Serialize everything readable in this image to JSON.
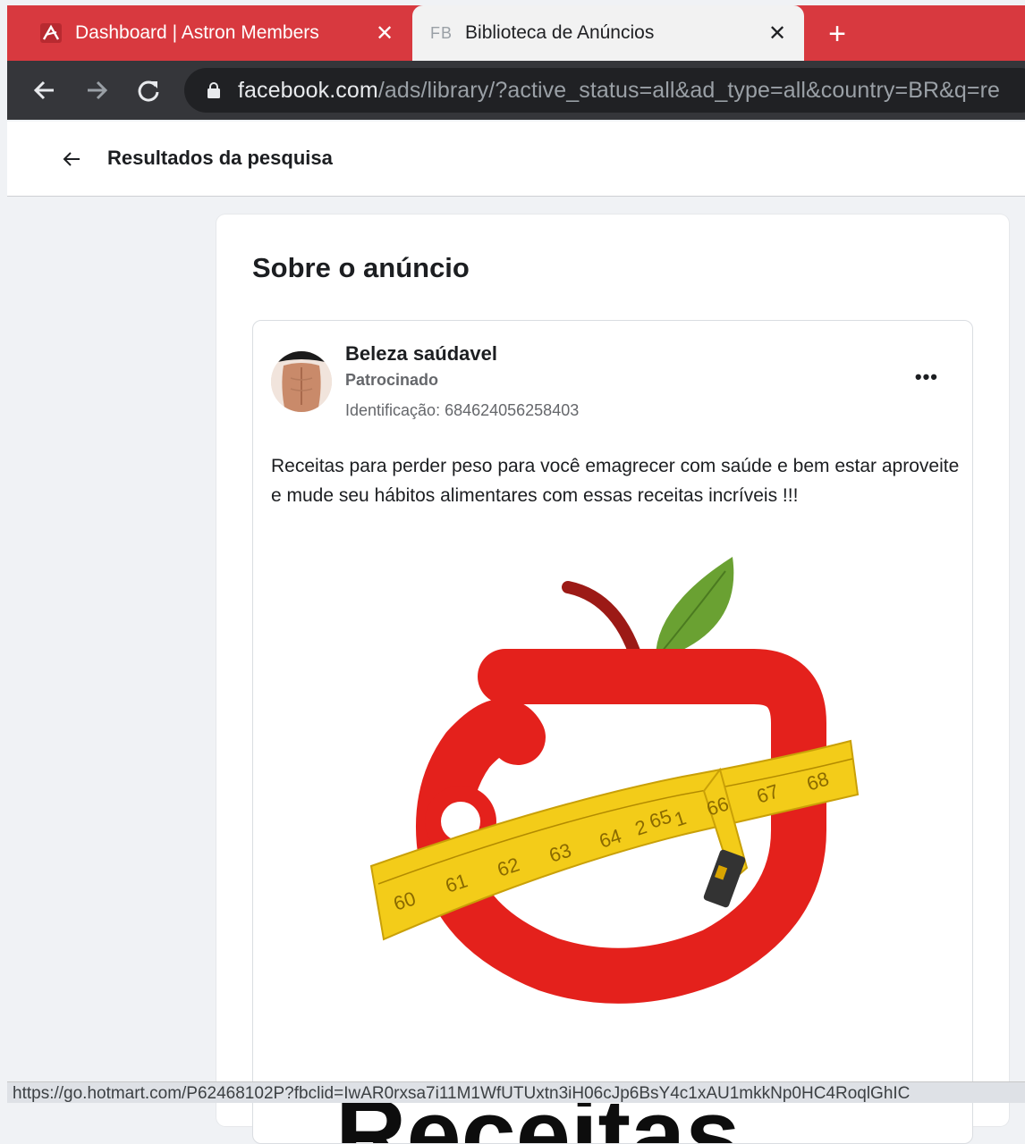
{
  "browser": {
    "tabs": [
      {
        "title": "Dashboard | Astron Members",
        "favicon": "astron-logo-icon",
        "active": false
      },
      {
        "title": "Biblioteca de Anúncios",
        "favicon_text": "FB",
        "active": true
      }
    ],
    "new_tab_symbol": "+",
    "close_symbol": "✕",
    "url_host": "facebook.com",
    "url_path": "/ads/library/?active_status=all&ad_type=all&country=BR&q=re",
    "status_url": "https://go.hotmart.com/P62468102P?fbclid=IwAR0rxsa7i11M1WfUTUxtn3iH06cJp6BsY4c1xAU1mkkNp0HC4RoqlGhIC",
    "colors": {
      "tabstrip": "#d8393f",
      "toolbar": "#35363a"
    }
  },
  "page": {
    "header_title": "Resultados da pesquisa",
    "panel_title": "Sobre o anúncio"
  },
  "ad": {
    "page_name": "Beleza saúdavel",
    "sponsored_label": "Patrocinado",
    "id_label": "Identificação: 684624056258403",
    "body": "Receitas para perder peso para você emagrecer com saúde e bem estar aproveite e mude seu hábitos alimentares com essas receitas incríveis !!!",
    "image": {
      "tape_numbers": [
        "60",
        "61",
        "62",
        "63",
        "64",
        "65",
        "66",
        "67",
        "68"
      ],
      "inner_numbers": [
        "2",
        "1"
      ],
      "visible_word": "Receitas"
    }
  }
}
